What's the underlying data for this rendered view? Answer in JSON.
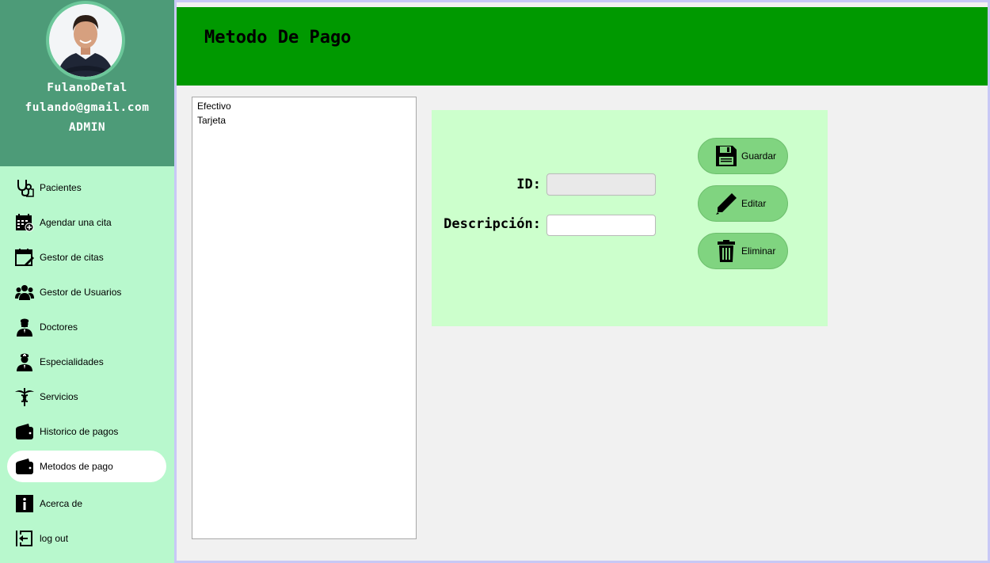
{
  "user": {
    "username": "FulanoDeTal",
    "email": "fulando@gmail.com",
    "role": "ADMIN"
  },
  "sidebar": {
    "items": [
      {
        "label": "Pacientes",
        "icon": "stethoscope-icon"
      },
      {
        "label": "Agendar una cita",
        "icon": "calendar-add-icon"
      },
      {
        "label": "Gestor de citas",
        "icon": "calendar-edit-icon"
      },
      {
        "label": "Gestor de Usuarios",
        "icon": "users-icon"
      },
      {
        "label": "Doctores",
        "icon": "doctor-icon"
      },
      {
        "label": "Especialidades",
        "icon": "doctor-specialty-icon"
      },
      {
        "label": "Servicios",
        "icon": "caduceus-icon"
      },
      {
        "label": "Historico de pagos",
        "icon": "wallet-icon"
      },
      {
        "label": "Metodos de pago",
        "icon": "wallet-icon",
        "active": true
      },
      {
        "label": "Acerca de",
        "icon": "info-icon"
      },
      {
        "label": "log out",
        "icon": "logout-icon"
      }
    ]
  },
  "header": {
    "title": "Metodo De Pago"
  },
  "methods_list": {
    "items": [
      "Efectivo",
      "Tarjeta"
    ]
  },
  "form": {
    "id_label": "ID:",
    "id_value": "",
    "description_label": "Descripción:",
    "description_value": ""
  },
  "buttons": {
    "save": "Guardar",
    "edit": "Editar",
    "delete": "Eliminar"
  },
  "colors": {
    "header_bg": "#009900",
    "sidebar_bg": "#b8f8cd",
    "profile_bg": "#4d9b78",
    "panel_bg": "#ccffcc",
    "button_bg": "#80d480"
  }
}
